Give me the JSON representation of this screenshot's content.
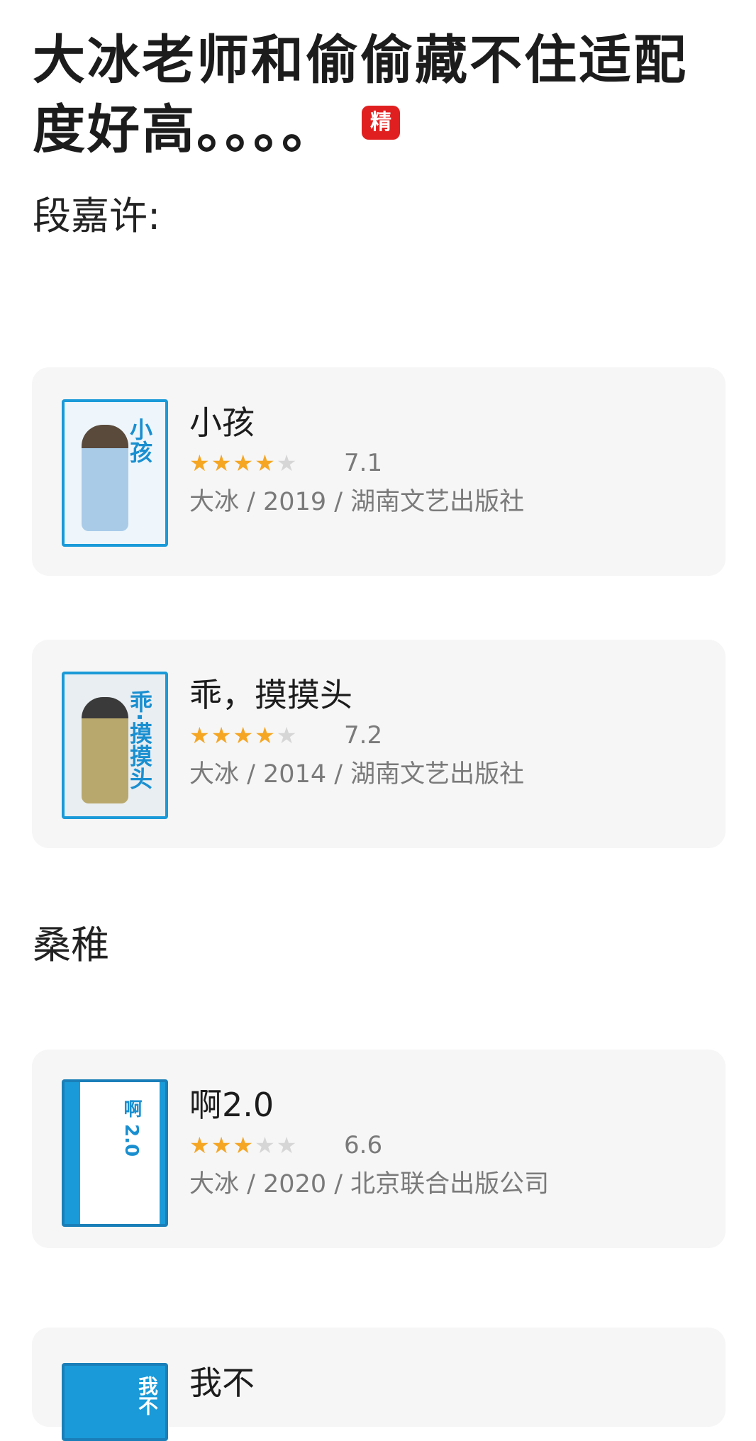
{
  "post": {
    "title": "大冰老师和偷偷藏不住适配度好高。。。。",
    "badge": "精"
  },
  "sections": [
    {
      "heading": "段嘉许:",
      "books": [
        {
          "title": "小孩",
          "cover_text": "小孩",
          "rating": "7.1",
          "stars": 3.5,
          "meta": "大冰 / 2019 / 湖南文艺出版社"
        },
        {
          "title": "乖，摸摸头",
          "cover_text": "乖·摸摸头",
          "rating": "7.2",
          "stars": 3.5,
          "meta": "大冰 / 2014 / 湖南文艺出版社"
        }
      ]
    },
    {
      "heading": "桑稚",
      "books": [
        {
          "title": "啊2.0",
          "cover_text": "啊 2.0",
          "rating": "6.6",
          "stars": 3,
          "meta": "大冰 / 2020 / 北京联合出版公司"
        },
        {
          "title": "我不",
          "cover_text": "我不",
          "rating": "",
          "stars": 0,
          "meta": ""
        }
      ]
    }
  ],
  "colors": {
    "accent_blue": "#1a9ad8",
    "star": "#f5a623",
    "badge_red": "#e02020"
  }
}
